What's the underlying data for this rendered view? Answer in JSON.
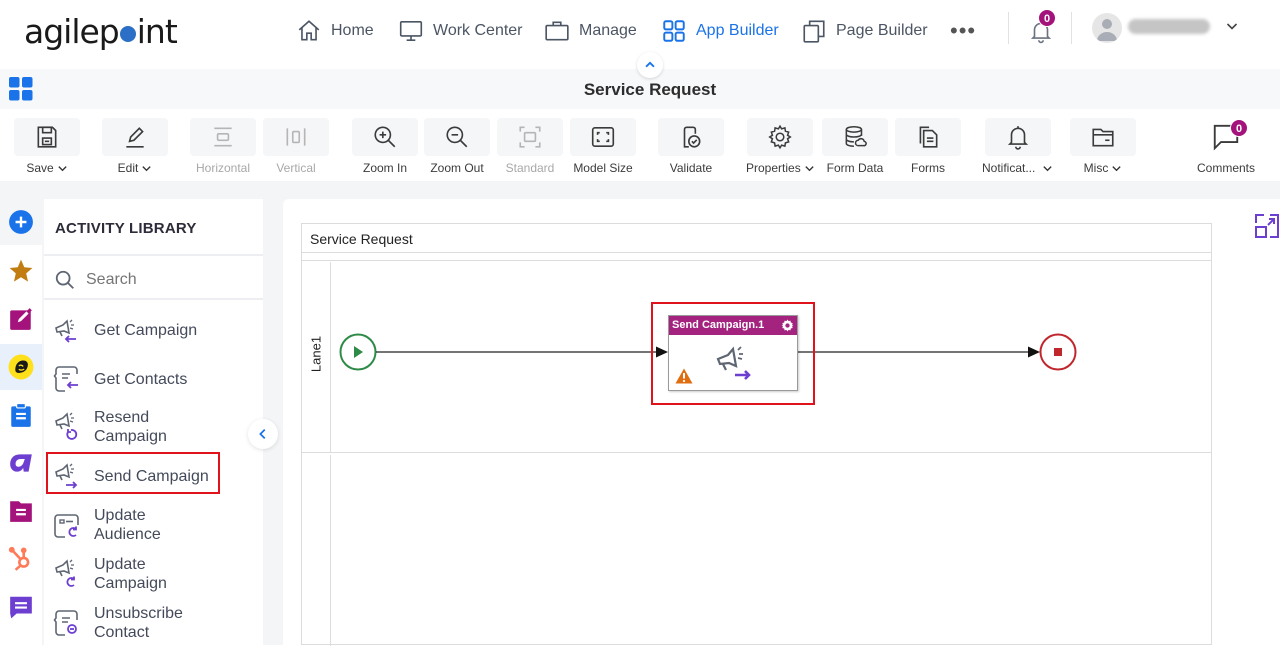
{
  "topnav": {
    "logo_pre": "agilep",
    "logo_post": "int",
    "items": [
      {
        "label": "Home",
        "icon": "home-icon"
      },
      {
        "label": "Work Center",
        "icon": "monitor-icon"
      },
      {
        "label": "Manage",
        "icon": "briefcase-icon"
      },
      {
        "label": "App Builder",
        "icon": "grid-icon",
        "active": true
      },
      {
        "label": "Page Builder",
        "icon": "pages-icon"
      }
    ],
    "more_label": "•••",
    "notifications_count": "0"
  },
  "titlebar": {
    "title": "Service Request"
  },
  "toolbar": {
    "items": [
      {
        "label": "Save",
        "dropdown": true,
        "enabled": true
      },
      {
        "label": "Edit",
        "dropdown": true,
        "enabled": true
      },
      {
        "label": "Horizontal",
        "dropdown": false,
        "enabled": false
      },
      {
        "label": "Vertical",
        "dropdown": false,
        "enabled": false
      },
      {
        "label": "Zoom In",
        "dropdown": false,
        "enabled": true
      },
      {
        "label": "Zoom Out",
        "dropdown": false,
        "enabled": true
      },
      {
        "label": "Standard",
        "dropdown": false,
        "enabled": false
      },
      {
        "label": "Model Size",
        "dropdown": false,
        "enabled": true
      },
      {
        "label": "Validate",
        "dropdown": false,
        "enabled": true
      },
      {
        "label": "Properties",
        "dropdown": true,
        "enabled": true
      },
      {
        "label": "Form Data",
        "dropdown": false,
        "enabled": true
      },
      {
        "label": "Forms",
        "dropdown": false,
        "enabled": true
      },
      {
        "label": "Notificat...",
        "dropdown": true,
        "enabled": true
      },
      {
        "label": "Misc",
        "dropdown": true,
        "enabled": true
      }
    ],
    "comments_label": "Comments",
    "comments_count": "0"
  },
  "rail": {
    "items": [
      {
        "name": "add-activity",
        "color": "#1a73e8"
      },
      {
        "name": "favorites",
        "color": "#c17d11"
      },
      {
        "name": "forms",
        "color": "#a4137b"
      },
      {
        "name": "mailchimp",
        "color": "#ffe01b",
        "selected": true
      },
      {
        "name": "clipboard",
        "color": "#1a73e8"
      },
      {
        "name": "adobe-sign",
        "color": "#6c3fd1"
      },
      {
        "name": "documents",
        "color": "#a4137b"
      },
      {
        "name": "hubspot",
        "color": "#ff7a59"
      },
      {
        "name": "chat",
        "color": "#6c3fd1"
      }
    ]
  },
  "library": {
    "title": "ACTIVITY LIBRARY",
    "search_placeholder": "Search",
    "items": [
      {
        "label": "Get Campaign",
        "icon": "get-campaign-icon"
      },
      {
        "label": "Get Contacts",
        "icon": "get-contacts-icon"
      },
      {
        "label": "Resend Campaign",
        "icon": "resend-campaign-icon"
      },
      {
        "label": "Send Campaign",
        "icon": "send-campaign-icon",
        "highlighted": true
      },
      {
        "label": "Update Audience",
        "icon": "update-audience-icon"
      },
      {
        "label": "Update Campaign",
        "icon": "update-campaign-icon"
      },
      {
        "label": "Unsubscribe Contact",
        "icon": "unsubscribe-contact-icon"
      }
    ]
  },
  "canvas": {
    "pool_title": "Service Request",
    "lanes": [
      "Lane1",
      ""
    ],
    "task": {
      "title": "Send Campaign.1",
      "header_color": "#a3237f",
      "has_warning": true
    },
    "colors": {
      "start": "#2e8b47",
      "end": "#c0272d",
      "highlight": "#e0121b",
      "accent_purple": "#6c3fd1"
    }
  }
}
